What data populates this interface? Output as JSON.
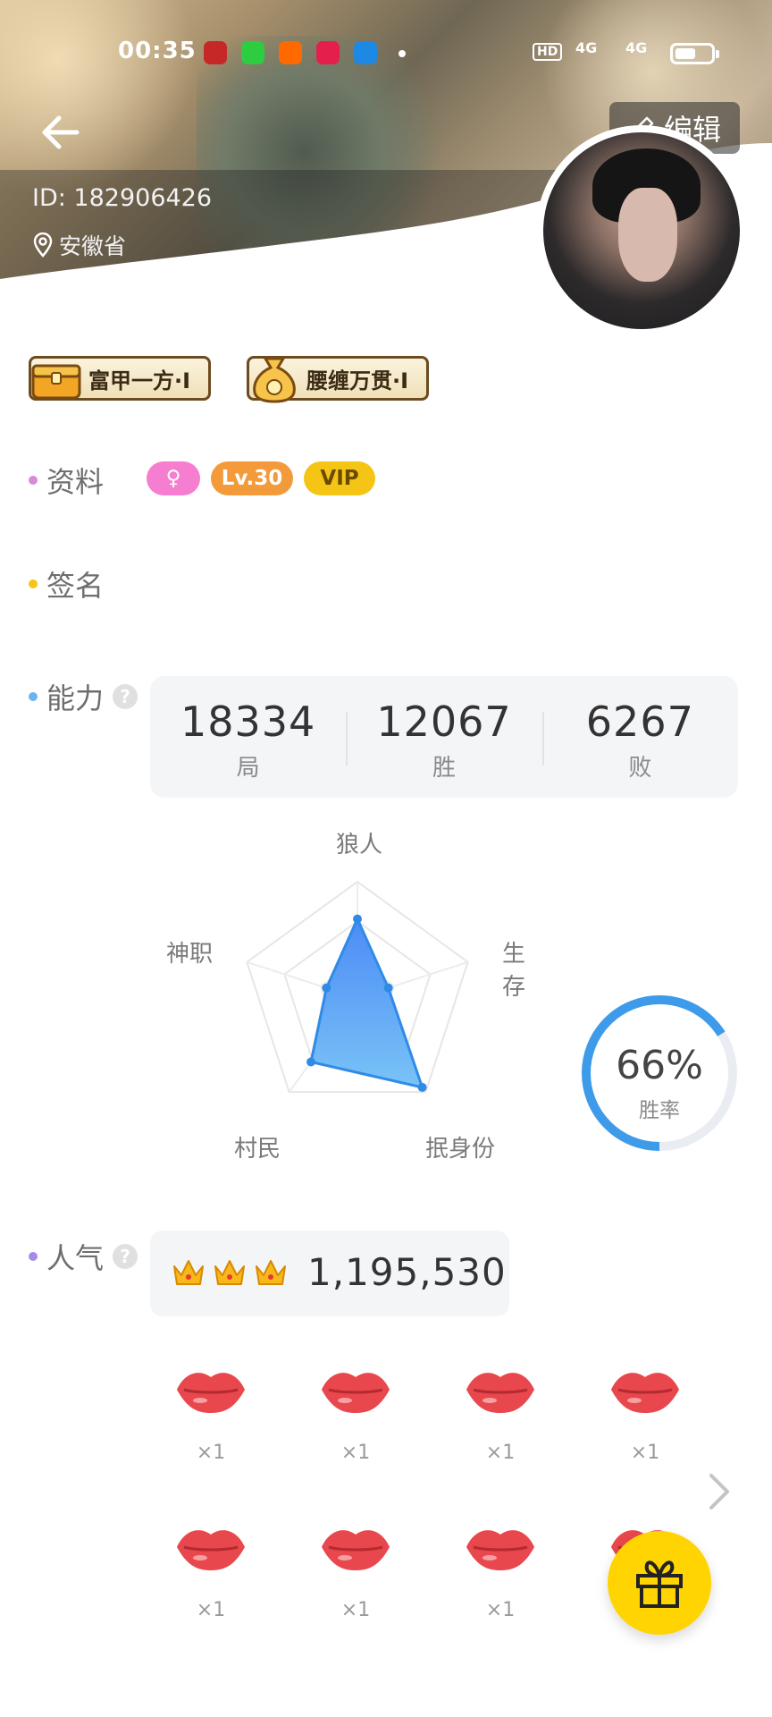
{
  "status_bar": {
    "time": "00:35",
    "right_text": "HD",
    "network_1": "4G",
    "network_2": "4G"
  },
  "header": {
    "edit_label": "编辑",
    "user_id": "ID: 182906426",
    "location": "安徽省"
  },
  "badges": [
    {
      "label": "富甲一方·I"
    },
    {
      "label": "腰缠万贯·I"
    }
  ],
  "profile": {
    "section_label": "资料",
    "tags": [
      {
        "label": "♀",
        "color": "#f57ed0"
      },
      {
        "label": "Lv.30",
        "color": "#f39a3a"
      },
      {
        "label": "VIP",
        "color": "#f5c516"
      }
    ]
  },
  "signature": {
    "section_label": "签名"
  },
  "ability": {
    "section_label": "能力",
    "help_icon": "?",
    "stats": [
      {
        "value": "18334",
        "label": "局"
      },
      {
        "value": "12067",
        "label": "胜"
      },
      {
        "value": "6267",
        "label": "败"
      }
    ]
  },
  "radar": {
    "axes": [
      "狼人",
      "生存",
      "抿身份",
      "村民",
      "神职"
    ],
    "values": [
      0.68,
      0.28,
      0.95,
      0.68,
      0.28
    ]
  },
  "winrate": {
    "value": "66%",
    "label": "胜率",
    "fraction": 0.66,
    "color": "#3d9be9"
  },
  "popularity": {
    "section_label": "人气",
    "value": "1,195,530",
    "crowns": 3
  },
  "gifts": [
    {
      "count": "×1"
    },
    {
      "count": "×1"
    },
    {
      "count": "×1"
    },
    {
      "count": "×1"
    },
    {
      "count": "×1"
    },
    {
      "count": "×1"
    },
    {
      "count": "×1"
    }
  ]
}
